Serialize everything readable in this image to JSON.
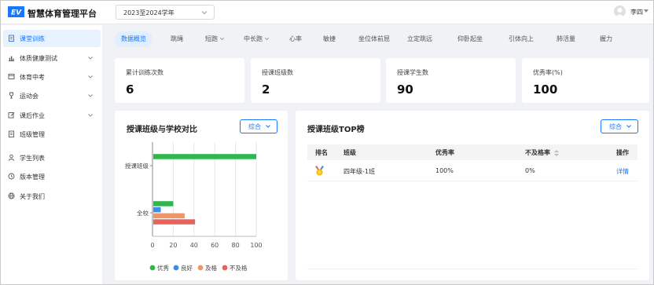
{
  "header": {
    "app_title": "智慧体育管理平台",
    "year_select": "2023至2024学年",
    "user_name": "李四"
  },
  "sidebar": {
    "items": [
      {
        "label": "课堂训练",
        "icon": "clipboard-icon",
        "active": true,
        "expandable": false
      },
      {
        "label": "体质健康测试",
        "icon": "bar-chart-icon",
        "active": false,
        "expandable": true
      },
      {
        "label": "体育中考",
        "icon": "exam-icon",
        "active": false,
        "expandable": true
      },
      {
        "label": "运动会",
        "icon": "trophy-icon",
        "active": false,
        "expandable": true
      },
      {
        "label": "课后作业",
        "icon": "edit-icon",
        "active": false,
        "expandable": true
      },
      {
        "label": "班级管理",
        "icon": "class-icon",
        "active": false,
        "expandable": false
      },
      {
        "label": "学生列表",
        "icon": "user-icon",
        "active": false,
        "expandable": false
      },
      {
        "label": "版本管理",
        "icon": "history-icon",
        "active": false,
        "expandable": false
      },
      {
        "label": "关于我们",
        "icon": "globe-icon",
        "active": false,
        "expandable": false
      }
    ]
  },
  "tabs": [
    {
      "label": "数据概览",
      "active": true,
      "dropdown": false
    },
    {
      "label": "跳绳",
      "active": false,
      "dropdown": false
    },
    {
      "label": "短跑",
      "active": false,
      "dropdown": true
    },
    {
      "label": "中长跑",
      "active": false,
      "dropdown": true
    },
    {
      "label": "心率",
      "active": false,
      "dropdown": false
    },
    {
      "label": "敏捷",
      "active": false,
      "dropdown": false
    },
    {
      "label": "坐位体前屈",
      "active": false,
      "dropdown": false
    },
    {
      "label": "立定跳远",
      "active": false,
      "dropdown": false
    },
    {
      "label": "仰卧起坐",
      "active": false,
      "dropdown": false
    },
    {
      "label": "引体向上",
      "active": false,
      "dropdown": false
    },
    {
      "label": "肺活量",
      "active": false,
      "dropdown": false
    },
    {
      "label": "握力",
      "active": false,
      "dropdown": false
    }
  ],
  "stats": [
    {
      "label": "累计训练次数",
      "value": "6"
    },
    {
      "label": "授课班级数",
      "value": "2"
    },
    {
      "label": "授课学生数",
      "value": "90"
    },
    {
      "label": "优秀率(%)",
      "value": "100"
    }
  ],
  "compare_panel": {
    "title": "授课班级与学校对比",
    "select_label": "综合"
  },
  "top_panel": {
    "title": "授课班级TOP榜",
    "select_label": "综合",
    "columns": [
      "排名",
      "班级",
      "优秀率",
      "不及格率",
      "操作"
    ],
    "rows": [
      {
        "rank_icon": "medal-icon",
        "class_name": "四年级-1班",
        "excellent_rate": "100%",
        "fail_rate": "0%",
        "action": "详情"
      }
    ]
  },
  "colors": {
    "accent": "#1677ff",
    "excellent": "#2db84d",
    "good": "#3a8ee6",
    "pass": "#f0956a",
    "fail": "#e8625d"
  },
  "chart_data": {
    "type": "bar",
    "orientation": "horizontal",
    "title": "授课班级与学校对比",
    "categories": [
      "授课班级",
      "全校"
    ],
    "series": [
      {
        "name": "优秀",
        "color": "#2db84d",
        "values": [
          100,
          20
        ]
      },
      {
        "name": "良好",
        "color": "#3a8ee6",
        "values": [
          0,
          8
        ]
      },
      {
        "name": "及格",
        "color": "#f0956a",
        "values": [
          0,
          31
        ]
      },
      {
        "name": "不及格",
        "color": "#e8625d",
        "values": [
          0,
          41
        ]
      }
    ],
    "x_ticks": [
      "0",
      "20",
      "40",
      "60",
      "80",
      "100"
    ],
    "xlim": [
      0,
      100
    ],
    "grid": true,
    "legend_position": "bottom"
  }
}
